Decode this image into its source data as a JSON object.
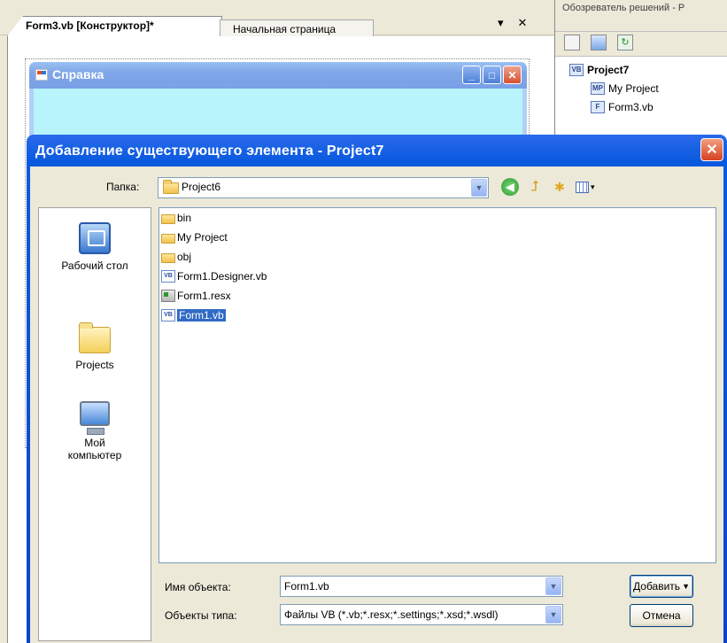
{
  "ide": {
    "doc_tab_active": "Form3.vb [Конструктор]*",
    "doc_tab_inactive": "Начальная страница",
    "tab_dropdown": "▾",
    "tab_close": "✕",
    "form_title": "Справка",
    "form_min": "_",
    "form_max": "□",
    "form_close": "✕",
    "solution_title": "Обозреватель решений - P",
    "tree": {
      "project": "Project7",
      "project_icon": "VB",
      "items": [
        {
          "label": "My Project",
          "icon": "MP"
        },
        {
          "label": "Form3.vb",
          "icon": "F"
        }
      ]
    }
  },
  "dialog": {
    "title": "Добавление существующего элемента - Project7",
    "close": "✕",
    "folder_label": "Папка:",
    "folder_value": "Project6",
    "places": [
      {
        "label": "Рабочий стол",
        "icon": "desktop-icon"
      },
      {
        "label": "Projects",
        "icon": "folder-icon"
      },
      {
        "label": "Мой компьютер",
        "icon": "computer-icon"
      }
    ],
    "files": [
      {
        "name": "bin",
        "type": "folder"
      },
      {
        "name": "My Project",
        "type": "folder"
      },
      {
        "name": "obj",
        "type": "folder"
      },
      {
        "name": "Form1.Designer.vb",
        "type": "vb"
      },
      {
        "name": "Form1.resx",
        "type": "resx"
      },
      {
        "name": "Form1.vb",
        "type": "vb",
        "selected": true
      }
    ],
    "name_label": "Имя объекта:",
    "name_value": "Form1.vb",
    "type_label": "Объекты типа:",
    "type_value": "Файлы VB (*.vb;*.resx;*.settings;*.xsd;*.wsdl)",
    "add_button": "Добавить",
    "cancel_button": "Отмена",
    "combo_arrow": "▼"
  },
  "colors": {
    "title_blue": "#0846c8",
    "selection": "#316ac5",
    "form_bg": "#b8f4fb"
  }
}
